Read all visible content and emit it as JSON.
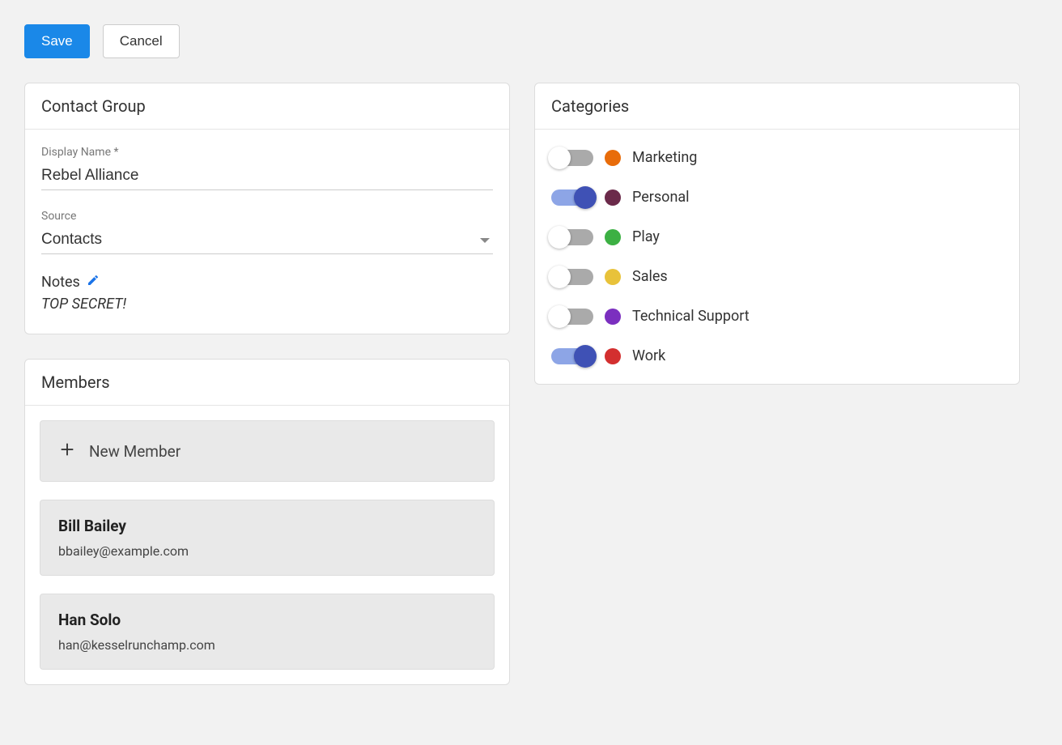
{
  "toolbar": {
    "save_label": "Save",
    "cancel_label": "Cancel"
  },
  "contact_group": {
    "panel_title": "Contact Group",
    "display_name_label": "Display Name *",
    "display_name_value": "Rebel Alliance",
    "source_label": "Source",
    "source_value": "Contacts",
    "notes_label": "Notes",
    "notes_value": "TOP SECRET!"
  },
  "members": {
    "panel_title": "Members",
    "new_member_label": "New Member",
    "items": [
      {
        "name": "Bill Bailey",
        "email": "bbailey@example.com"
      },
      {
        "name": "Han Solo",
        "email": "han@kesselrunchamp.com"
      }
    ]
  },
  "categories": {
    "panel_title": "Categories",
    "items": [
      {
        "label": "Marketing",
        "color": "#e86c0a",
        "enabled": false
      },
      {
        "label": "Personal",
        "color": "#6b2a4a",
        "enabled": true
      },
      {
        "label": "Play",
        "color": "#3cb043",
        "enabled": false
      },
      {
        "label": "Sales",
        "color": "#e8c23a",
        "enabled": false
      },
      {
        "label": "Technical Support",
        "color": "#7b2fbf",
        "enabled": false
      },
      {
        "label": "Work",
        "color": "#d32f2f",
        "enabled": true
      }
    ]
  }
}
